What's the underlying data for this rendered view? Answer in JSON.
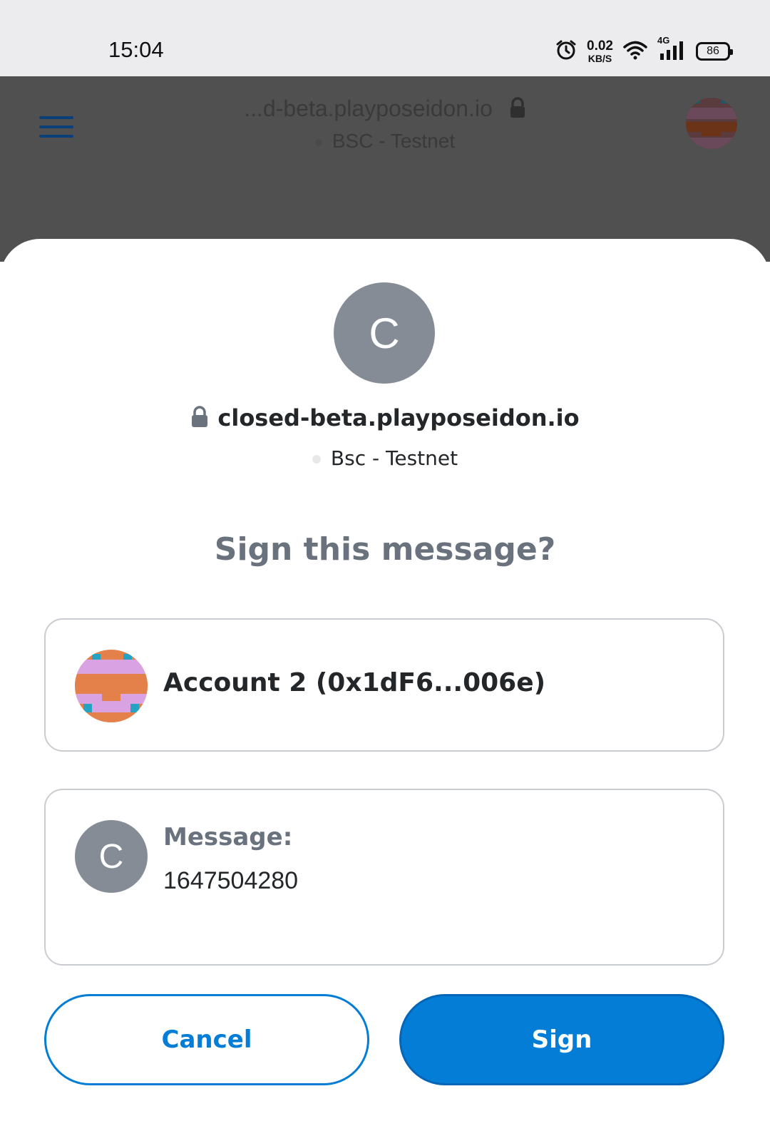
{
  "status_bar": {
    "time": "15:04",
    "net_speed_value": "0.02",
    "net_speed_unit": "KB/S",
    "network_type": "4G",
    "battery": "86",
    "icons": [
      "alarm-icon",
      "wifi-icon",
      "cellular-signal-icon",
      "battery-icon"
    ]
  },
  "browser": {
    "url": "...d-beta.playposeidon.io",
    "network": "BSC - Testnet",
    "icons": [
      "menu-icon",
      "lock-icon",
      "account-avatar"
    ]
  },
  "dialog": {
    "site_initial": "C",
    "site_url": "closed-beta.playposeidon.io",
    "network": "Bsc - Testnet",
    "title": "Sign this message?",
    "account_label": "Account 2 (0x1dF6...006e)",
    "message_initial": "C",
    "message_title": "Message:",
    "message_body": "1647504280",
    "cancel_label": "Cancel",
    "sign_label": "Sign"
  },
  "colors": {
    "primary": "#037dd6",
    "muted_text": "#6a737d",
    "text": "#24272a",
    "icon_grey": "#858c95",
    "overlay": "#505050"
  }
}
